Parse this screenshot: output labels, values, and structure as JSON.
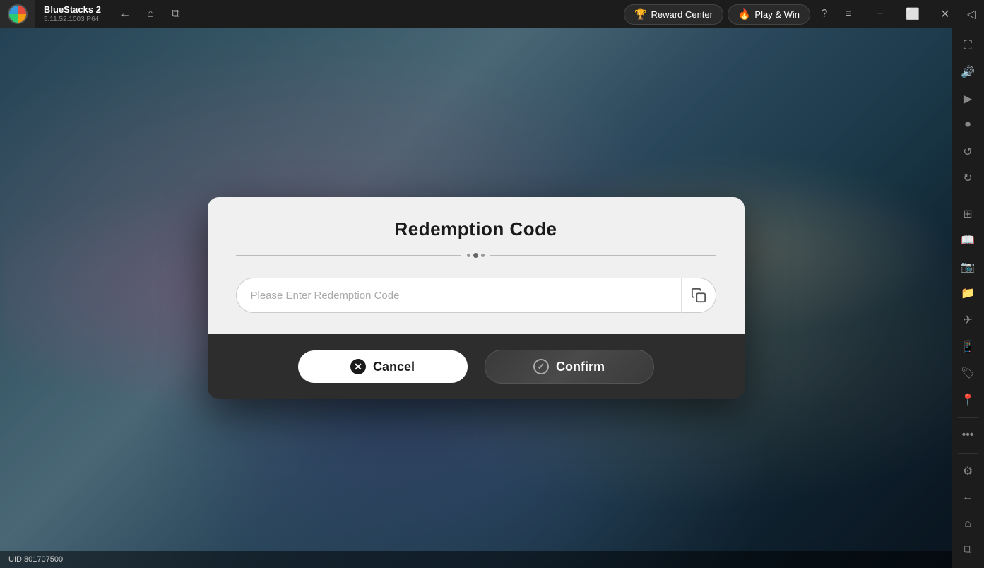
{
  "app": {
    "name": "BlueStacks 2",
    "version": "5.11.52.1003  P64"
  },
  "titlebar": {
    "back_label": "←",
    "home_label": "⌂",
    "copy_label": "⧉",
    "reward_center_label": "Reward Center",
    "play_win_label": "Play & Win",
    "help_label": "?",
    "menu_label": "≡",
    "minimize_label": "−",
    "restore_label": "⬜",
    "close_label": "✕",
    "expand_label": "◁"
  },
  "sidebar": {
    "icons": [
      {
        "name": "fullscreen-icon",
        "symbol": "⛶"
      },
      {
        "name": "volume-icon",
        "symbol": "🔊"
      },
      {
        "name": "video-icon",
        "symbol": "▶"
      },
      {
        "name": "camera-icon",
        "symbol": "📷"
      },
      {
        "name": "rotate-icon",
        "symbol": "↺"
      },
      {
        "name": "rotate2-icon",
        "symbol": "↻"
      },
      {
        "name": "grid-icon",
        "symbol": "⊞"
      },
      {
        "name": "book-icon",
        "symbol": "📖"
      },
      {
        "name": "screenshot-icon",
        "symbol": "⬚"
      },
      {
        "name": "folder-icon",
        "symbol": "📁"
      },
      {
        "name": "plane-icon",
        "symbol": "✈"
      },
      {
        "name": "phone-icon",
        "symbol": "📱"
      },
      {
        "name": "tag-icon",
        "symbol": "🏷"
      },
      {
        "name": "location-icon",
        "symbol": "📍"
      },
      {
        "name": "more-icon",
        "symbol": "•••"
      },
      {
        "name": "settings-icon",
        "symbol": "⚙"
      },
      {
        "name": "back-icon",
        "symbol": "←"
      },
      {
        "name": "home2-icon",
        "symbol": "⌂"
      },
      {
        "name": "copy2-icon",
        "symbol": "⧉"
      }
    ]
  },
  "dialog": {
    "title": "Redemption Code",
    "input_placeholder": "Please Enter Redemption Code",
    "cancel_label": "Cancel",
    "confirm_label": "Confirm"
  },
  "status": {
    "uid_label": "UID:801707500"
  }
}
